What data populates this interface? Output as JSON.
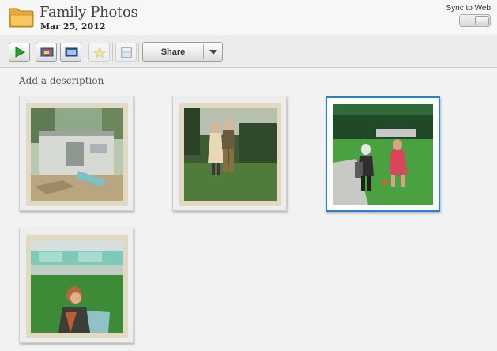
{
  "album": {
    "title": "Family Photos",
    "date": "Mar 25, 2012"
  },
  "sync": {
    "label": "Sync to Web",
    "enabled": false
  },
  "toolbar": {
    "buttons": [
      {
        "name": "play-slideshow-button",
        "icon": "play-icon",
        "enabled": true
      },
      {
        "name": "edit-photo-button",
        "icon": "photo-edit-icon",
        "enabled": true
      },
      {
        "name": "create-project-button",
        "icon": "filmstrip-icon",
        "enabled": true
      },
      {
        "name": "favorite-button",
        "icon": "star-icon",
        "enabled": false
      },
      {
        "name": "save-button",
        "icon": "floppy-disk-icon",
        "enabled": false
      }
    ],
    "share_label": "Share"
  },
  "description_placeholder": "Add a description",
  "photos": [
    {
      "name": "photo-trailer-yard",
      "selected": false
    },
    {
      "name": "photo-couple-standing",
      "selected": false
    },
    {
      "name": "photo-men-sitting-lawn",
      "selected": true
    },
    {
      "name": "photo-woman-lawn-chair",
      "selected": false
    }
  ],
  "colors": {
    "accent_selected": "#2b7fd6",
    "play_green": "#2aa12a"
  }
}
